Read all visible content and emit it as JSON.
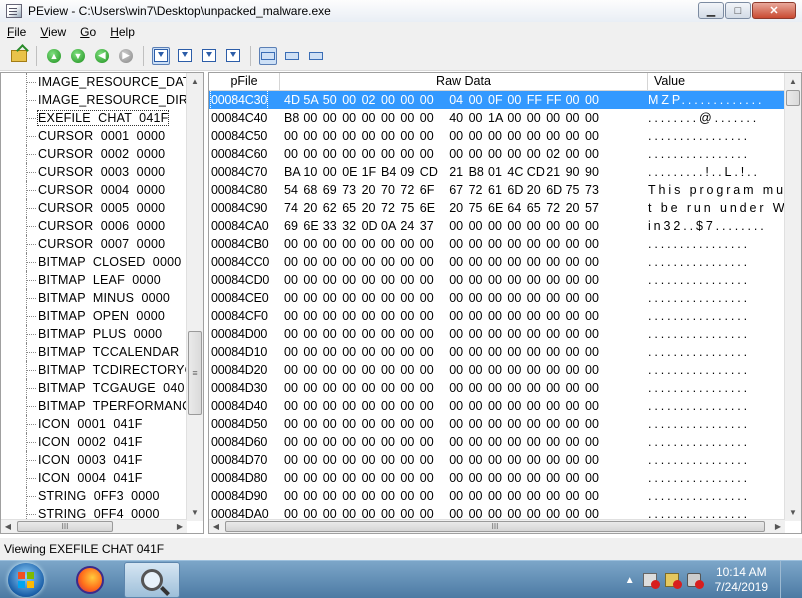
{
  "window": {
    "title": "PEview - C:\\Users\\win7\\Desktop\\unpacked_malware.exe",
    "buttons": {
      "minimize": "▁",
      "maximize": "□",
      "close": "✕"
    }
  },
  "menu": [
    "File",
    "View",
    "Go",
    "Help"
  ],
  "toolbar": {
    "icons": [
      "open-icon",
      "first-icon",
      "back-icon",
      "forward-icon",
      "last-icon",
      "view-hex-icon",
      "view-address-icon",
      "import-down-icon",
      "export-down-icon",
      "view-mode-1",
      "view-mode-2",
      "view-mode-3"
    ]
  },
  "tree": {
    "selected_index": 2,
    "items": [
      "IMAGE_RESOURCE_DATA",
      "IMAGE_RESOURCE_DIR",
      "EXEFILE  CHAT  041F",
      "CURSOR  0001  0000",
      "CURSOR  0002  0000",
      "CURSOR  0003  0000",
      "CURSOR  0004  0000",
      "CURSOR  0005  0000",
      "CURSOR  0006  0000",
      "CURSOR  0007  0000",
      "BITMAP  CLOSED  0000",
      "BITMAP  LEAF  0000",
      "BITMAP  MINUS  0000",
      "BITMAP  OPEN  0000",
      "BITMAP  PLUS  0000",
      "BITMAP  TCCALENDAR",
      "BITMAP  TCDIRECTORYC",
      "BITMAP  TCGAUGE  040",
      "BITMAP  TPERFORMANCE",
      "ICON  0001  041F",
      "ICON  0002  041F",
      "ICON  0003  041F",
      "ICON  0004  041F",
      "STRING  0FF3  0000",
      "STRING  0FF4  0000"
    ]
  },
  "hexview": {
    "headers": {
      "pfile": "pFile",
      "raw": "Raw Data",
      "value": "Value"
    },
    "selected_index": 0,
    "rows": [
      {
        "addr": "00084C30",
        "bytes": [
          "4D",
          "5A",
          "50",
          "00",
          "02",
          "00",
          "00",
          "00",
          "04",
          "00",
          "0F",
          "00",
          "FF",
          "FF",
          "00",
          "00"
        ],
        "ascii": "MZP............."
      },
      {
        "addr": "00084C40",
        "bytes": [
          "B8",
          "00",
          "00",
          "00",
          "00",
          "00",
          "00",
          "00",
          "40",
          "00",
          "1A",
          "00",
          "00",
          "00",
          "00",
          "00"
        ],
        "ascii": "........@......."
      },
      {
        "addr": "00084C50",
        "bytes": [
          "00",
          "00",
          "00",
          "00",
          "00",
          "00",
          "00",
          "00",
          "00",
          "00",
          "00",
          "00",
          "00",
          "00",
          "00",
          "00"
        ],
        "ascii": "................"
      },
      {
        "addr": "00084C60",
        "bytes": [
          "00",
          "00",
          "00",
          "00",
          "00",
          "00",
          "00",
          "00",
          "00",
          "00",
          "00",
          "00",
          "00",
          "02",
          "00",
          "00"
        ],
        "ascii": "................"
      },
      {
        "addr": "00084C70",
        "bytes": [
          "BA",
          "10",
          "00",
          "0E",
          "1F",
          "B4",
          "09",
          "CD",
          "21",
          "B8",
          "01",
          "4C",
          "CD",
          "21",
          "90",
          "90"
        ],
        "ascii": ".........!..L.!.."
      },
      {
        "addr": "00084C80",
        "bytes": [
          "54",
          "68",
          "69",
          "73",
          "20",
          "70",
          "72",
          "6F",
          "67",
          "72",
          "61",
          "6D",
          "20",
          "6D",
          "75",
          "73"
        ],
        "ascii": "This program mus"
      },
      {
        "addr": "00084C90",
        "bytes": [
          "74",
          "20",
          "62",
          "65",
          "20",
          "72",
          "75",
          "6E",
          "20",
          "75",
          "6E",
          "64",
          "65",
          "72",
          "20",
          "57"
        ],
        "ascii": "t be run under W"
      },
      {
        "addr": "00084CA0",
        "bytes": [
          "69",
          "6E",
          "33",
          "32",
          "0D",
          "0A",
          "24",
          "37",
          "00",
          "00",
          "00",
          "00",
          "00",
          "00",
          "00",
          "00"
        ],
        "ascii": "in32..$7........"
      },
      {
        "addr": "00084CB0",
        "bytes": [
          "00",
          "00",
          "00",
          "00",
          "00",
          "00",
          "00",
          "00",
          "00",
          "00",
          "00",
          "00",
          "00",
          "00",
          "00",
          "00"
        ],
        "ascii": "................"
      },
      {
        "addr": "00084CC0",
        "bytes": [
          "00",
          "00",
          "00",
          "00",
          "00",
          "00",
          "00",
          "00",
          "00",
          "00",
          "00",
          "00",
          "00",
          "00",
          "00",
          "00"
        ],
        "ascii": "................"
      },
      {
        "addr": "00084CD0",
        "bytes": [
          "00",
          "00",
          "00",
          "00",
          "00",
          "00",
          "00",
          "00",
          "00",
          "00",
          "00",
          "00",
          "00",
          "00",
          "00",
          "00"
        ],
        "ascii": "................"
      },
      {
        "addr": "00084CE0",
        "bytes": [
          "00",
          "00",
          "00",
          "00",
          "00",
          "00",
          "00",
          "00",
          "00",
          "00",
          "00",
          "00",
          "00",
          "00",
          "00",
          "00"
        ],
        "ascii": "................"
      },
      {
        "addr": "00084CF0",
        "bytes": [
          "00",
          "00",
          "00",
          "00",
          "00",
          "00",
          "00",
          "00",
          "00",
          "00",
          "00",
          "00",
          "00",
          "00",
          "00",
          "00"
        ],
        "ascii": "................"
      },
      {
        "addr": "00084D00",
        "bytes": [
          "00",
          "00",
          "00",
          "00",
          "00",
          "00",
          "00",
          "00",
          "00",
          "00",
          "00",
          "00",
          "00",
          "00",
          "00",
          "00"
        ],
        "ascii": "................"
      },
      {
        "addr": "00084D10",
        "bytes": [
          "00",
          "00",
          "00",
          "00",
          "00",
          "00",
          "00",
          "00",
          "00",
          "00",
          "00",
          "00",
          "00",
          "00",
          "00",
          "00"
        ],
        "ascii": "................"
      },
      {
        "addr": "00084D20",
        "bytes": [
          "00",
          "00",
          "00",
          "00",
          "00",
          "00",
          "00",
          "00",
          "00",
          "00",
          "00",
          "00",
          "00",
          "00",
          "00",
          "00"
        ],
        "ascii": "................"
      },
      {
        "addr": "00084D30",
        "bytes": [
          "00",
          "00",
          "00",
          "00",
          "00",
          "00",
          "00",
          "00",
          "00",
          "00",
          "00",
          "00",
          "00",
          "00",
          "00",
          "00"
        ],
        "ascii": "................"
      },
      {
        "addr": "00084D40",
        "bytes": [
          "00",
          "00",
          "00",
          "00",
          "00",
          "00",
          "00",
          "00",
          "00",
          "00",
          "00",
          "00",
          "00",
          "00",
          "00",
          "00"
        ],
        "ascii": "................"
      },
      {
        "addr": "00084D50",
        "bytes": [
          "00",
          "00",
          "00",
          "00",
          "00",
          "00",
          "00",
          "00",
          "00",
          "00",
          "00",
          "00",
          "00",
          "00",
          "00",
          "00"
        ],
        "ascii": "................"
      },
      {
        "addr": "00084D60",
        "bytes": [
          "00",
          "00",
          "00",
          "00",
          "00",
          "00",
          "00",
          "00",
          "00",
          "00",
          "00",
          "00",
          "00",
          "00",
          "00",
          "00"
        ],
        "ascii": "................"
      },
      {
        "addr": "00084D70",
        "bytes": [
          "00",
          "00",
          "00",
          "00",
          "00",
          "00",
          "00",
          "00",
          "00",
          "00",
          "00",
          "00",
          "00",
          "00",
          "00",
          "00"
        ],
        "ascii": "................"
      },
      {
        "addr": "00084D80",
        "bytes": [
          "00",
          "00",
          "00",
          "00",
          "00",
          "00",
          "00",
          "00",
          "00",
          "00",
          "00",
          "00",
          "00",
          "00",
          "00",
          "00"
        ],
        "ascii": "................"
      },
      {
        "addr": "00084D90",
        "bytes": [
          "00",
          "00",
          "00",
          "00",
          "00",
          "00",
          "00",
          "00",
          "00",
          "00",
          "00",
          "00",
          "00",
          "00",
          "00",
          "00"
        ],
        "ascii": "................"
      },
      {
        "addr": "00084DA0",
        "bytes": [
          "00",
          "00",
          "00",
          "00",
          "00",
          "00",
          "00",
          "00",
          "00",
          "00",
          "00",
          "00",
          "00",
          "00",
          "00",
          "00"
        ],
        "ascii": "................"
      }
    ]
  },
  "scroll": {
    "left_vertical_position": 0.73,
    "left_horizontal_symbol": "III",
    "right_horizontal_symbol": "III",
    "vertical_symbol": "≡"
  },
  "status": {
    "text": "Viewing EXEFILE  CHAT  041F"
  },
  "taskbar": {
    "time": "10:14 AM",
    "date": "7/24/2019",
    "tray_arrow": "▲"
  }
}
